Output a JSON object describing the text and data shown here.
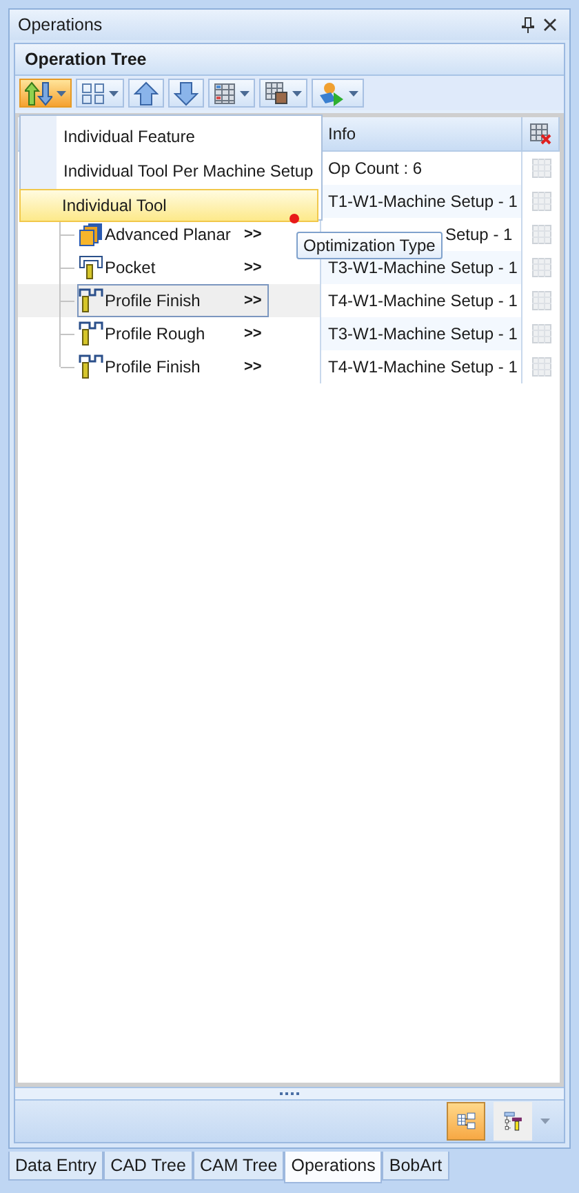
{
  "window": {
    "title": "Operations"
  },
  "panel": {
    "title": "Operation Tree"
  },
  "toolbar": [
    {
      "kind": "sort",
      "dropdown": true,
      "selected": true
    },
    {
      "kind": "view",
      "dropdown": true,
      "selected": false
    },
    {
      "kind": "up",
      "dropdown": false,
      "selected": false
    },
    {
      "kind": "down",
      "dropdown": false,
      "selected": false
    },
    {
      "kind": "grid",
      "dropdown": true,
      "selected": false
    },
    {
      "kind": "export",
      "dropdown": true,
      "selected": false
    },
    {
      "kind": "run",
      "dropdown": true,
      "selected": false
    }
  ],
  "table": {
    "columns": [
      "Info"
    ],
    "rows": [
      {
        "info": "Op Count : 6",
        "covered": false,
        "selected": false
      },
      {
        "info": "T1-W1-Machine Setup - 1",
        "covered": false,
        "selected": false
      },
      {
        "kind": "planar",
        "name": "Advanced Planar",
        "arrow": ">>",
        "info": "Setup - 1",
        "covered": true,
        "selected": false
      },
      {
        "kind": "pocket",
        "name": "Pocket",
        "arrow": ">>",
        "info": "T3-W1-Machine Setup - 1",
        "covered": false,
        "selected": false
      },
      {
        "kind": "profile",
        "name": "Profile Finish",
        "arrow": ">>",
        "info": "T4-W1-Machine Setup - 1",
        "covered": false,
        "selected": true
      },
      {
        "kind": "profile",
        "name": "Profile Rough",
        "arrow": ">>",
        "info": "T3-W1-Machine Setup - 1",
        "covered": false,
        "selected": false
      },
      {
        "kind": "profile",
        "name": "Profile Finish",
        "arrow": ">>",
        "info": "T4-W1-Machine Setup - 1",
        "covered": false,
        "selected": false
      }
    ]
  },
  "menu": {
    "items": [
      {
        "label": "Individual Feature",
        "selected": false
      },
      {
        "label": "Individual Tool Per Machine Setup",
        "selected": false
      },
      {
        "label": "Individual Tool",
        "selected": true
      }
    ]
  },
  "tooltip": {
    "text": "Optimization Type"
  },
  "bottom_bar": {
    "views": [
      {
        "kind": "table",
        "selected": true
      },
      {
        "kind": "tree",
        "selected": false
      }
    ]
  },
  "tabs": [
    {
      "label": "Data Entry",
      "selected": false
    },
    {
      "label": "CAD Tree",
      "selected": false
    },
    {
      "label": "CAM Tree",
      "selected": false
    },
    {
      "label": "Operations",
      "selected": true
    },
    {
      "label": "BobArt",
      "selected": false
    }
  ]
}
